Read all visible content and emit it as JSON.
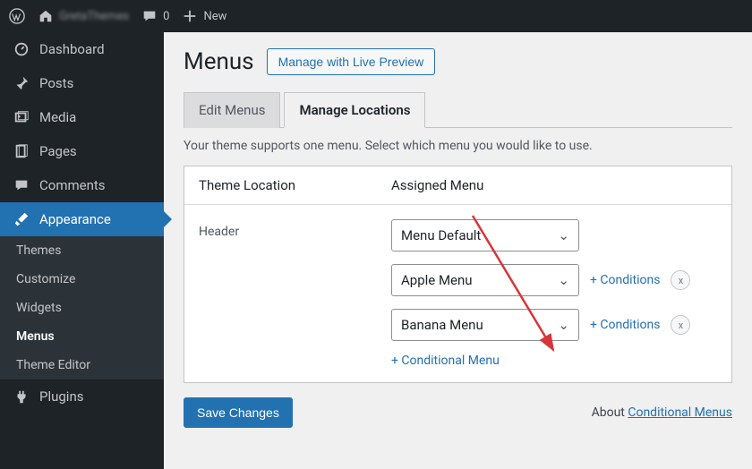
{
  "adminbar": {
    "site_name": "GretaThemes",
    "comments_count": "0",
    "new_label": "New"
  },
  "sidebar": {
    "items": [
      {
        "label": "Dashboard"
      },
      {
        "label": "Posts"
      },
      {
        "label": "Media"
      },
      {
        "label": "Pages"
      },
      {
        "label": "Comments"
      },
      {
        "label": "Appearance"
      },
      {
        "label": "Plugins"
      }
    ],
    "appearance_submenu": [
      {
        "label": "Themes"
      },
      {
        "label": "Customize"
      },
      {
        "label": "Widgets"
      },
      {
        "label": "Menus"
      },
      {
        "label": "Theme Editor"
      }
    ]
  },
  "page": {
    "title": "Menus",
    "live_preview_btn": "Manage with Live Preview",
    "tabs": {
      "edit": "Edit Menus",
      "locations": "Manage Locations"
    },
    "helper": "Your theme supports one menu. Select which menu you would like to use.",
    "table": {
      "head_loc": "Theme Location",
      "head_menu": "Assigned Menu",
      "location_name": "Header",
      "menu_default": "Menu Default",
      "menu_apple": "Apple Menu",
      "menu_banana": "Banana Menu",
      "conditions_link": "+ Conditions",
      "remove_x": "x",
      "add_conditional": "+ Conditional Menu"
    },
    "save_btn": "Save Changes",
    "about_prefix": "About ",
    "about_link": "Conditional Menus"
  }
}
